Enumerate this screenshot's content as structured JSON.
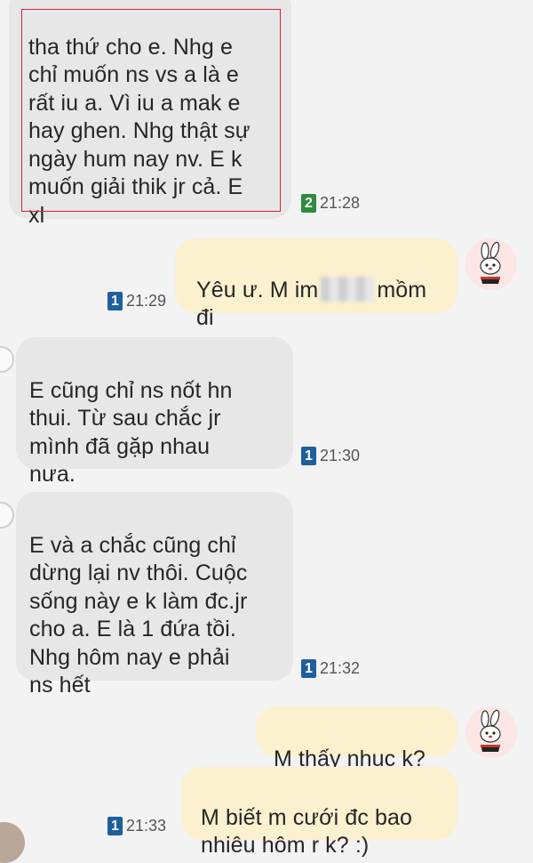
{
  "messages": [
    {
      "direction": "incoming",
      "text": "tha thứ cho e. Nhg e\nchỉ muốn ns vs a là e\nrất iu a. Vì iu a mak e\nhay ghen. Nhg thật sự\nngày hum nay nv. E k\nmuốn giải thik jr cả. E\nxl",
      "sim": "2",
      "time": "21:28"
    },
    {
      "direction": "outgoing",
      "text_before": "Yêu ư. M im",
      "text_after": "mồm\nđi",
      "sim": "1",
      "time": "21:29"
    },
    {
      "direction": "incoming",
      "text": "E cũng chỉ ns nốt hn\nthui. Từ sau chắc jr\nmình đã gặp nhau\nnưa.",
      "sim": "1",
      "time": "21:30"
    },
    {
      "direction": "incoming",
      "text": "E và a chắc cũng chỉ\ndừng lại nv thôi. Cuộc\nsống này e k làm đc.jr\ncho a. E là 1 đứa tồi.\nNhg hôm nay e phải\nns hết",
      "sim": "1",
      "time": "21:32"
    },
    {
      "direction": "outgoing",
      "text": "M thấy nhục k?"
    },
    {
      "direction": "outgoing",
      "text": "M biết m cưới đc bao\nnhiêu hôm r k? :)",
      "sim": "1",
      "time": "21:33"
    }
  ],
  "colors": {
    "background": "#f3f3f3",
    "incoming_bubble": "#e7e7e7",
    "outgoing_bubble": "#fbf1cf",
    "sim1_badge": "#1e5f9e",
    "sim2_badge": "#2e8b3e",
    "highlight_border": "#d3223a"
  },
  "icons": {
    "contact_avatar": "bunny-magician-avatar-icon",
    "sim_badge": "sim-card-icon"
  }
}
